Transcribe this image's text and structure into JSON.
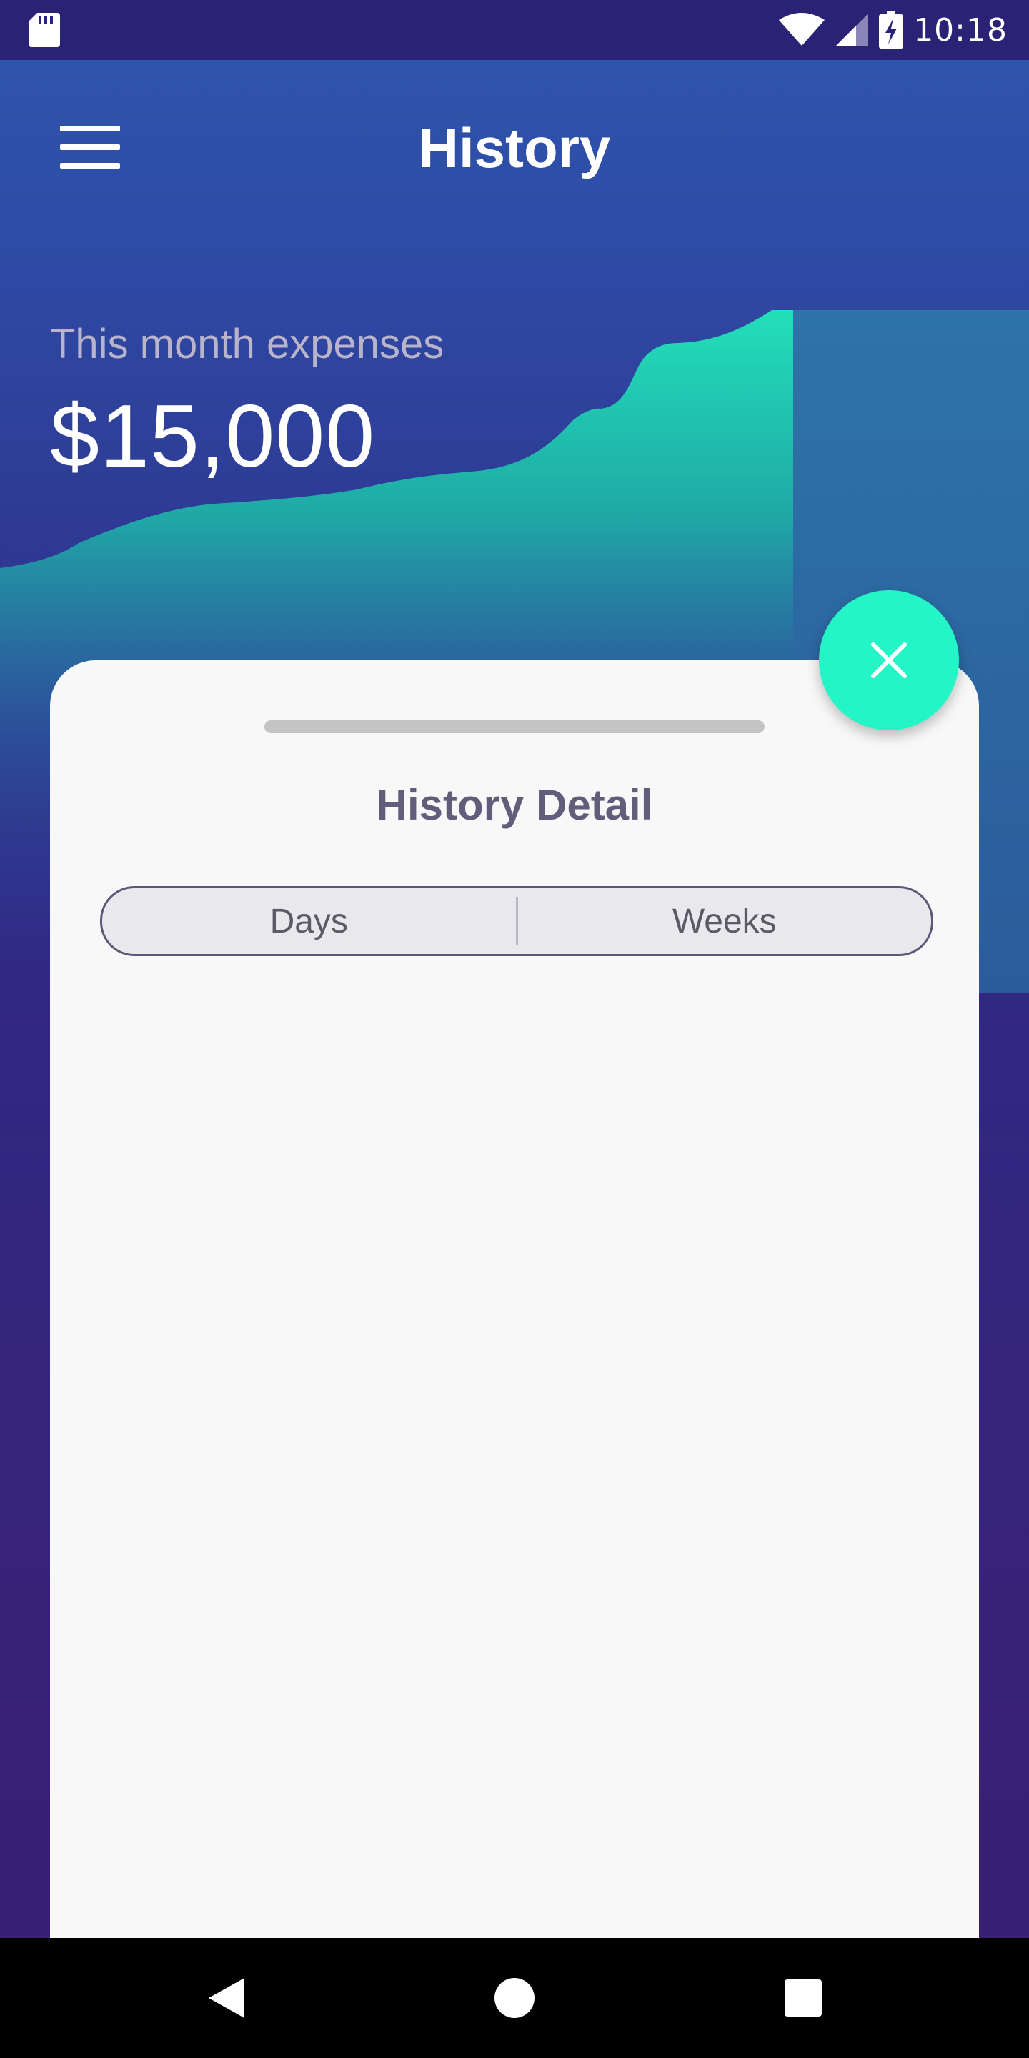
{
  "status_bar": {
    "time": "10:18",
    "icons": [
      "sd-card-icon",
      "wifi-icon",
      "signal-icon",
      "battery-charging-icon"
    ]
  },
  "header": {
    "title": "History",
    "menu_icon": "hamburger-menu-icon"
  },
  "summary": {
    "label": "This month expenses",
    "amount": "$15,000"
  },
  "detail_sheet": {
    "title": "History Detail",
    "tabs": [
      {
        "label": "Days"
      },
      {
        "label": "Weeks"
      }
    ]
  },
  "fab": {
    "icon": "close-icon"
  },
  "nav_bar": {
    "icons": [
      "back-icon",
      "home-icon",
      "recents-icon"
    ]
  },
  "colors": {
    "accent": "#24f5c6",
    "header_bg": "#2f57ad",
    "background_dark": "#2f2a86",
    "card_bg": "#f8f8f9",
    "title_text": "#625d7a"
  }
}
